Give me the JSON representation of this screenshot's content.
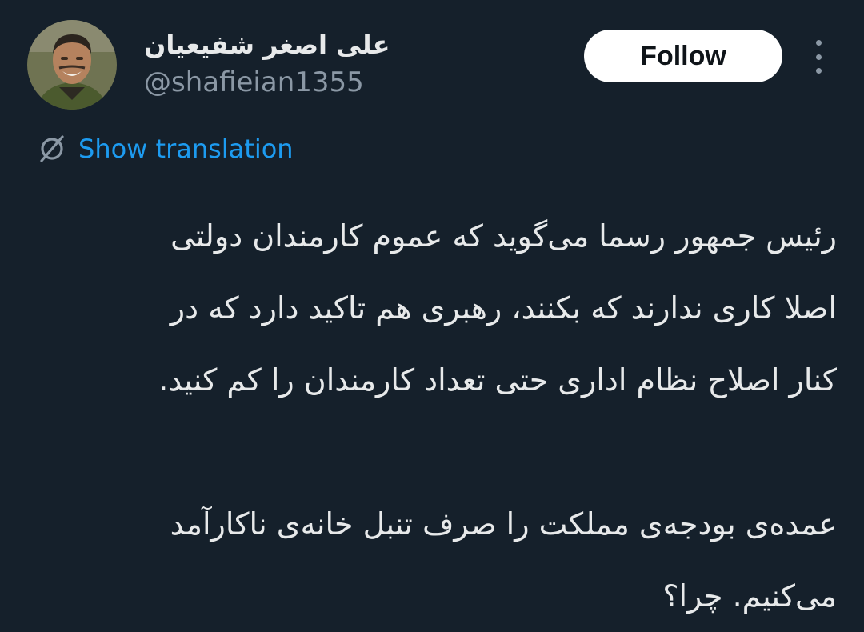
{
  "author": {
    "name": "علی اصغر شفیعیان",
    "handle": "@shafieian1355",
    "avatar_icon": "profile-photo"
  },
  "actions": {
    "follow_label": "Follow",
    "more_icon": "more-vertical-icon"
  },
  "translation": {
    "label": "Show translation",
    "icon": "translate-icon"
  },
  "tweet": {
    "lines": [
      "رئیس جمهور رسما می‌گوید که عموم کارمندان دولتی",
      "اصلا کاری ندارند که بکنند، رهبری هم تاکید دارد که در",
      "کنار اصلاح نظام اداری حتی تعداد کارمندان را کم کنید.",
      "",
      "عمده‌ی بودجه‌ی مملکت را صرف تنبل خانه‌ی ناکارآمد",
      "می‌کنیم. چرا؟"
    ]
  },
  "colors": {
    "background": "#15202b",
    "text": "#e7e9ea",
    "muted": "#8b98a5",
    "link": "#1d9bf0",
    "button_bg": "#ffffff"
  }
}
